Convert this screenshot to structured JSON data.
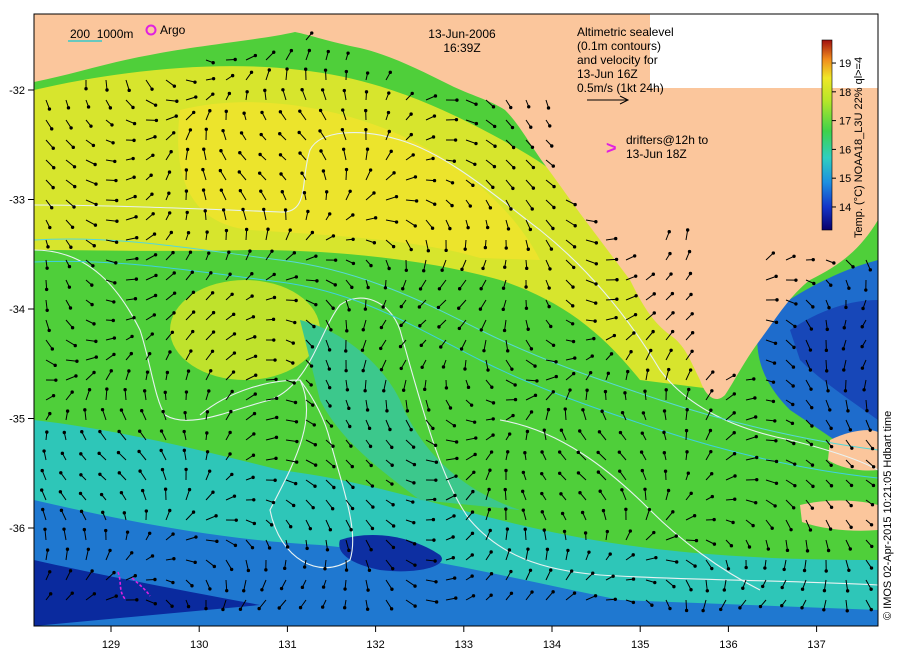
{
  "header": {
    "date": "13-Jun-2006",
    "time": "16:39Z"
  },
  "legend": {
    "isobath_label": "200  1000m",
    "argo_label": "Argo",
    "altimetry_lines": [
      "Altimetric sealevel",
      "(0.1m contours)",
      "and velocity for",
      "13-Jun 16Z",
      "0.5m/s (1kt 24h)"
    ],
    "drifters_symbol": ">",
    "drifters_lines": [
      "drifters@12h to",
      "13-Jun 18Z"
    ]
  },
  "colorbar": {
    "title": "Temp. (°C) NOAA18_L3U 22% ql>=4",
    "ticks": [
      "14",
      "15",
      "16",
      "17",
      "18",
      "19"
    ],
    "range": [
      13.2,
      19.8
    ]
  },
  "axes": {
    "lon_ticks": [
      "129",
      "130",
      "131",
      "132",
      "133",
      "134",
      "135",
      "136",
      "137"
    ],
    "lat_ticks": [
      "-32",
      "-33",
      "-34",
      "-35",
      "-36"
    ]
  },
  "credit": "© IMOS 02-Apr-2015 10:21:05 Hdbart time",
  "colors": {
    "land": "#fbc69c",
    "warm": "#e8ea2e",
    "green": "#5fd23c",
    "cyan": "#2fc7c4",
    "blue": "#1d63c9",
    "deep": "#08249a"
  }
}
